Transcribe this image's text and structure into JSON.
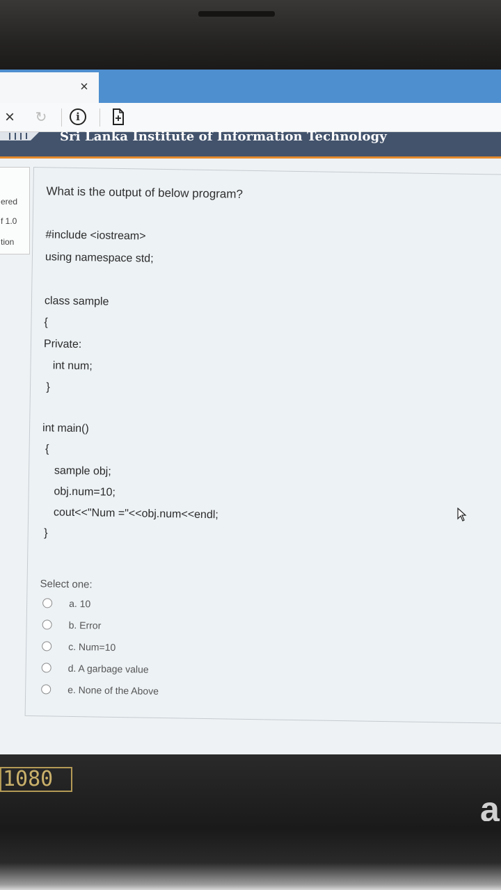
{
  "browser": {
    "tab_close": "×",
    "nav_stop": "×",
    "nav_reload": "↻",
    "nav_info": "i",
    "nav_page": "+"
  },
  "site": {
    "title": "Sri Lanka Institute of Information Technology",
    "header_color": "#43536c",
    "accent_color": "#e58a2c"
  },
  "side_panel": {
    "lines": [
      "ered",
      "f 1.0",
      "tion"
    ]
  },
  "question": {
    "prompt": "What is the output of below program?",
    "code": [
      "#include <iostream>",
      "using namespace std;",
      "class sample",
      "{",
      "Private:",
      "   int num;",
      " }",
      "int main()",
      " {",
      "    sample obj;",
      "    obj.num=10;",
      "    cout<<\"Num =\"<<obj.num<<endl;",
      " }"
    ],
    "select_label": "Select one:",
    "options": [
      "a. 10",
      "b. Error",
      "c. Num=10",
      "d. A garbage value",
      "e. None of the Above"
    ]
  },
  "laptop": {
    "badge": "1080",
    "brand_glyph": "a"
  }
}
